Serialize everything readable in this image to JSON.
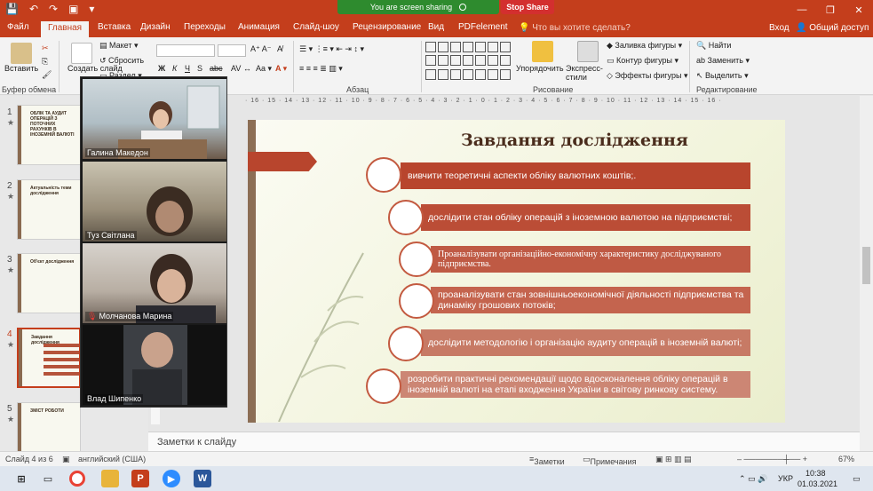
{
  "titlebar": {
    "qat": [
      "💾",
      "↶",
      "↷",
      "▣",
      "▾"
    ],
    "sharing": "You are screen sharing",
    "stop_share": "Stop Share",
    "controls": [
      "—",
      "❐",
      "✕"
    ]
  },
  "tabs": [
    "Файл",
    "Главная",
    "Вставка",
    "Дизайн",
    "Переходы",
    "Анимация",
    "Слайд-шоу",
    "Рецензирование",
    "Вид",
    "PDFelement"
  ],
  "active_tab": "Главная",
  "tell_me": "Что вы хотите сделать?",
  "login": "Вход",
  "share_label": "Общий доступ",
  "ribbon": {
    "paste": "Вставить",
    "clipboard_group": "Буфер обмена",
    "layout": "Макет",
    "reset": "Сбросить",
    "section": "Раздел",
    "create_slide": "Создать слайд",
    "font_name": "",
    "font_size": "",
    "bold": "Ж",
    "italic": "К",
    "underline": "Ч",
    "strike": "S",
    "abc": "abc",
    "paragraph_group": "Абзац",
    "arrange": "Упорядочить",
    "quick_styles": "Экспресс-стили",
    "drawing_group": "Рисование",
    "fill": "Заливка фигуры",
    "outline": "Контур фигуры",
    "effects": "Эффекты фигуры",
    "find": "Найти",
    "replace": "Заменить",
    "select": "Выделить",
    "editing_group": "Редактирование"
  },
  "thumbnails": [
    {
      "num": "1",
      "title": "ОБЛІК ТА АУДИТ ОПЕРАЦІЙ З ПОТОЧНИХ РАХУНКІВ В ІНОЗЕМНІЙ ВАЛЮТІ",
      "current": false
    },
    {
      "num": "2",
      "title": "Актуальність теми дослідження",
      "current": false
    },
    {
      "num": "3",
      "title": "Об'єкт дослідження",
      "current": false
    },
    {
      "num": "4",
      "title": "Завдання дослідження",
      "current": true
    },
    {
      "num": "5",
      "title": "ЗМІСТ РОБОТИ",
      "current": false
    }
  ],
  "participants": [
    {
      "name": "Галина Македон",
      "muted": false
    },
    {
      "name": "Туз Світлана",
      "muted": false
    },
    {
      "name": "Молчанова Марина",
      "muted": true
    },
    {
      "name": "Влад Шипенко",
      "muted": false
    }
  ],
  "ruler": "· 16 · 15 · 14 · 13 · 12 · 11 · 10 · 9 · 8 · 7 · 6 · 5 · 4 · 3 · 2 · 1 · 0 · 1 · 2 · 3 · 4 · 5 · 6 · 7 · 8 · 9 · 10 · 11 · 12 · 13 · 14 · 15 · 16 ·",
  "slide": {
    "title": "Завдання дослідження",
    "items": [
      "вивчити теоретичні аспекти обліку валютних коштів;.",
      "дослідити стан обліку операцій з іноземною валютою на підприємстві;",
      "Проаналізувати організаційно-економічну характеристику досліджуваного підприємства.",
      "проаналізувати стан  зовнішньоекономічної діяльності підприємства та динаміку грошових потоків;",
      "дослідити методологію і організацію аудиту операцій в іноземній валюті;",
      "розробити практичні рекомендації щодо вдосконалення обліку операцій в іноземній валюті на етапі входження України в світову ринкову систему."
    ]
  },
  "notes_placeholder": "Заметки к слайду",
  "status": {
    "slide_info": "Слайд 4 из 6",
    "language": "английский (США)",
    "notes": "Заметки",
    "comments": "Примечания",
    "zoom": "67%"
  },
  "taskbar": {
    "lang": "УКР",
    "time": "10:38",
    "date": "01.03.2021"
  }
}
